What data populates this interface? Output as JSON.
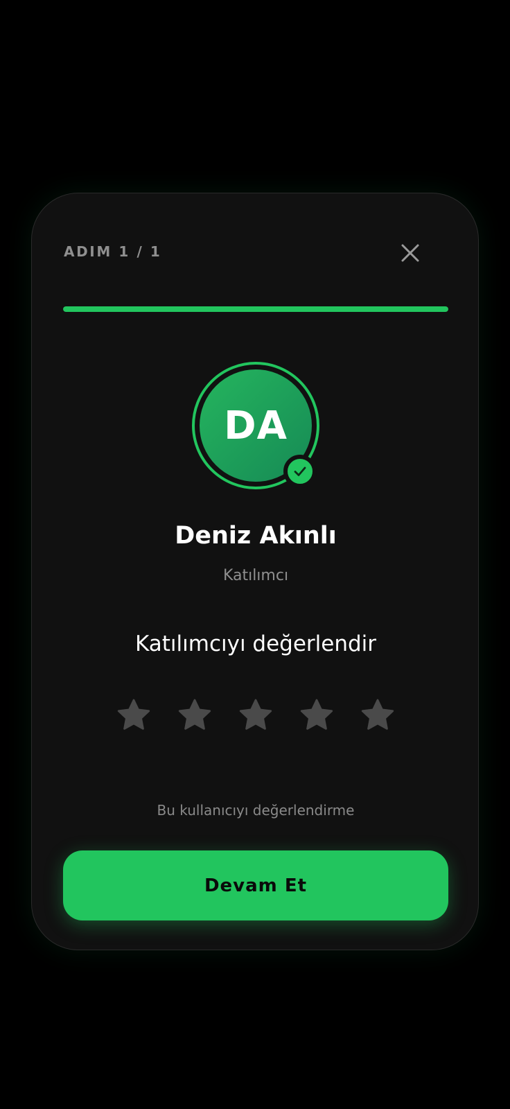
{
  "header": {
    "step_label": "ADIM 1 / 1",
    "close_icon": "close-icon"
  },
  "progress": {
    "fraction": 1.0
  },
  "user": {
    "initials": "DA",
    "name": "Deniz Akınlı",
    "role": "Katılımcı",
    "verified_icon": "check-icon"
  },
  "rating": {
    "title": "Katılımcıyı değerlendir",
    "max": 5,
    "value": 0,
    "star_icon": "star-icon"
  },
  "actions": {
    "skip_label": "Bu kullanıcıyı değerlendirme",
    "continue_label": "Devam Et"
  },
  "colors": {
    "accent": "#22c55e",
    "card_background": "#111111",
    "page_background": "#000000",
    "star_inactive": "#4a4a4a",
    "muted_text": "#8f8f8f"
  }
}
